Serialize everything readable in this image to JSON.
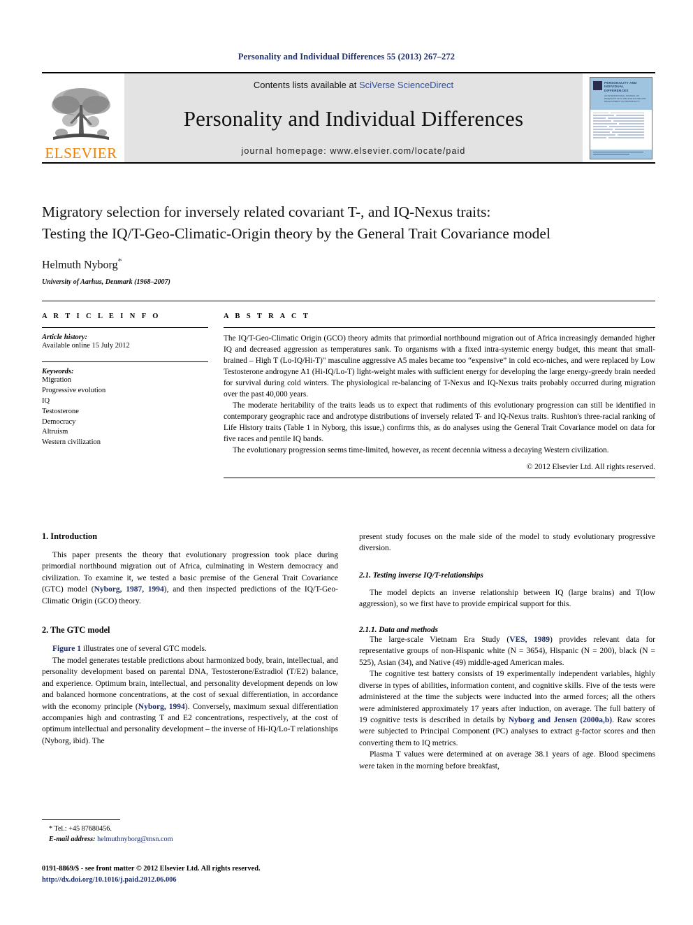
{
  "running_head": "Personality and Individual Differences 55 (2013) 267–272",
  "masthead": {
    "elsevier_wordmark": "ELSEVIER",
    "contents_prefix": "Contents lists available at ",
    "sciencedirect_link": "SciVerse ScienceDirect",
    "journal_name": "Personality and Individual Differences",
    "homepage": "journal homepage: www.elsevier.com/locate/paid",
    "cover": {
      "title": "PERSONALITY AND INDIVIDUAL DIFFERENCES",
      "subtitle": "AN INTERNATIONAL JOURNAL OF RESEARCH INTO THE STRUCTURE AND DEVELOPMENT OF PERSONALITY"
    },
    "accent_orange": "#f08000",
    "banner_gray": "#e3e3e3",
    "cover_blue": "#9ec4e0"
  },
  "title_block": {
    "title_line1": "Migratory selection for inversely related covariant T-, and IQ-Nexus traits:",
    "title_line2": "Testing the IQ/T-Geo-Climatic-Origin theory by the General Trait Covariance model",
    "author": "Helmuth Nyborg",
    "author_marker": "*",
    "affiliation": "University of Aarhus, Denmark (1968–2007)"
  },
  "article_info": {
    "heading": "A R T I C L E   I N F O",
    "history_label": "Article history:",
    "history_value": "Available online 15 July 2012",
    "keywords_label": "Keywords:",
    "keywords": [
      "Migration",
      "Progressive evolution",
      "IQ",
      "Testosterone",
      "Democracy",
      "Altruism",
      "Western civilization"
    ]
  },
  "abstract": {
    "heading": "A B S T R A C T",
    "paragraphs": [
      "The IQ/T-Geo-Climatic Origin (GCO) theory admits that primordial northbound migration out of Africa increasingly demanded higher IQ and decreased aggression as temperatures sank. To organisms with a fixed intra-systemic energy budget, this meant that small-brained – High T (Lo-IQ/Hi-T)\" masculine aggressive A5 males became too “expensive” in cold eco-niches, and were replaced by Low Testosterone androgyne A1 (Hi-IQ/Lo-T) light-weight males with sufficient energy for developing the large energy-greedy brain needed for survival during cold winters. The physiological re-balancing of T-Nexus and IQ-Nexus traits probably occurred during migration over the past 40,000 years.",
      "The moderate heritability of the traits leads us to expect that rudiments of this evolutionary progression can still be identified in contemporary geographic race and androtype distributions of inversely related T- and IQ-Nexus traits. Rushton's three-racial ranking of Life History traits (Table 1 in Nyborg, this issue,) confirms this, as do analyses using the General Trait Covariance model on data for five races and pentile IQ bands.",
      "The evolutionary progression seems time-limited, however, as recent decennia witness a decaying Western civilization."
    ],
    "copyright": "© 2012 Elsevier Ltd. All rights reserved."
  },
  "body": {
    "left": {
      "h_intro": "1. Introduction",
      "p_intro_1": "This paper presents the theory that evolutionary progression took place during primordial northbound migration out of Africa, culminating in Western democracy and civilization. To examine it, we tested a basic premise of the General Trait Covariance (GTC) model (",
      "p_intro_link": "Nyborg, 1987, 1994",
      "p_intro_2": "), and then inspected predictions of the IQ/T-Geo-Climatic Origin (GCO) theory.",
      "h_gtc": "2. The GTC model",
      "p_fig_link": "Figure 1",
      "p_fig_rest": " illustrates one of several GTC models.",
      "p_model_1": "The model generates testable predictions about harmonized body, brain, intellectual, and personality development based on parental DNA, Testosterone/Estradiol (T/E2) balance, and experience. Optimum brain, intellectual, and personality development depends on low and balanced hormone concentrations, at the cost of sexual differentiation, in accordance with the economy principle (",
      "p_model_link": "Nyborg, 1994",
      "p_model_2": "). Conversely, maximum sexual differentiation accompanies high and contrasting T and E2 concentrations, respectively, at the cost of optimum intellectual and personality development – the inverse of Hi-IQ/Lo-T relationships (Nyborg, ibid). The"
    },
    "right": {
      "p_cont": "present study focuses on the male side of the model to study evolutionary progressive diversion.",
      "h_testing": "2.1. Testing inverse IQ/T-relationships",
      "p_model_depicts": "The model depicts an inverse relationship between IQ (large brains) and T(low aggression), so we first have to provide empirical support for this.",
      "h_data": "2.1.1. Data and methods",
      "p_ves_1": "The large-scale Vietnam Era Study (",
      "p_ves_link": "VES, 1989",
      "p_ves_2": ") provides relevant data for representative groups of non-Hispanic white (N = 3654), Hispanic (N = 200), black (N = 525), Asian (34), and Native (49) middle-aged American males.",
      "p_battery_1": "The cognitive test battery consists of 19 experimentally independent variables, highly diverse in types of abilities, information content, and cognitive skills. Five of the tests were administered at the time the subjects were inducted into the armed forces; all the others were administered approximately 17 years after induction, on average. The full battery of 19 cognitive tests is described in details by ",
      "p_battery_link": "Nyborg and Jensen (2000a,b)",
      "p_battery_2": ". Raw scores were subjected to Principal Component (PC) analyses to extract g-factor scores and then converting them to IQ metrics.",
      "p_plasma": "Plasma T values were determined at on average 38.1 years of age. Blood specimens were taken in the morning before breakfast,"
    }
  },
  "footnote": {
    "marker": "*",
    "tel": "Tel.: +45 87680456.",
    "email_label": "E-mail address:",
    "email": "helmuthnyborg@msn.com"
  },
  "page_footer": {
    "issn_line": "0191-8869/$ - see front matter © 2012 Elsevier Ltd. All rights reserved.",
    "doi": "http://dx.doi.org/10.1016/j.paid.2012.06.006"
  }
}
